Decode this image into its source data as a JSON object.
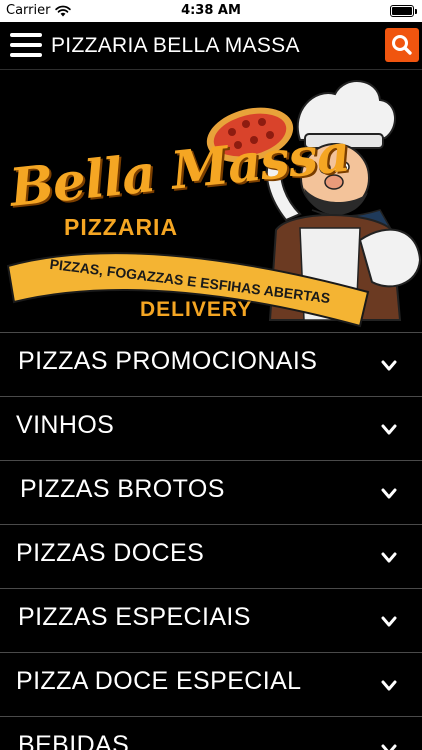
{
  "status_bar": {
    "carrier": "Carrier",
    "time": "4:38 AM"
  },
  "header": {
    "title": "PIZZARIA BELLA MASSA",
    "search_color": "#f0550f"
  },
  "banner": {
    "brand_name": "Bella Massa",
    "brand_subtitle": "PIZZARIA",
    "tagline": "PIZZAS, FOGAZZAS E ESFIHAS ABERTAS",
    "delivery": "DELIVERY",
    "accent_color": "#f5a623"
  },
  "categories": [
    {
      "label": "PIZZAS PROMOCIONAIS"
    },
    {
      "label": "VINHOS"
    },
    {
      "label": "PIZZAS BROTOS"
    },
    {
      "label": "PIZZAS DOCES"
    },
    {
      "label": "PIZZAS ESPECIAIS"
    },
    {
      "label": "PIZZA DOCE ESPECIAL"
    },
    {
      "label": "BEBIDAS"
    }
  ]
}
